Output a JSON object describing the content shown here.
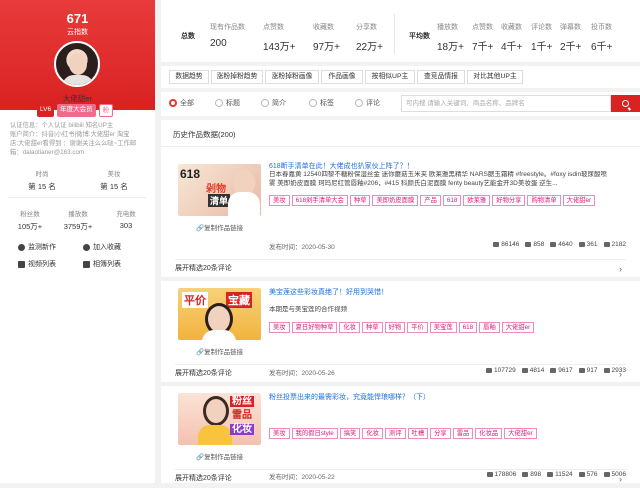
{
  "profile": {
    "rank": "671",
    "rank_label": "云指数",
    "name": "大佬甜er",
    "badges": [
      "LV6",
      "年度大会员",
      "粉"
    ],
    "info": [
      "认证信息：个人认证 bilibili 知名UP主",
      "账户简介：抖音|小红书|微博:大佬甜er 淘宝",
      "店:大佬甜er看得到 ：谢谢关注么么哒~工作邮",
      "箱：dalaotianer@163.com"
    ],
    "stat_row1": [
      {
        "label": "时尚",
        "value": "第 15 名"
      },
      {
        "label": "美妆",
        "value": "第 15 名"
      }
    ],
    "stat_row2": [
      {
        "label": "粉丝数",
        "value": "105万+"
      },
      {
        "label": "播放数",
        "value": "3759万+"
      },
      {
        "label": "充电数",
        "value": "303"
      }
    ],
    "actions": [
      {
        "icon": "monitor-icon",
        "label": "监测新作"
      },
      {
        "icon": "plus-circle-icon",
        "label": "加入收藏"
      },
      {
        "icon": "video-list-icon",
        "label": "视频列表"
      },
      {
        "icon": "album-list-icon",
        "label": "相簿列表"
      }
    ]
  },
  "totals": {
    "label": "总数",
    "cols": [
      {
        "label": "现有作品数",
        "value": "200"
      },
      {
        "label": "点赞数",
        "value": "143万+"
      },
      {
        "label": "收藏数",
        "value": "97万+"
      },
      {
        "label": "分享数",
        "value": "22万+"
      }
    ]
  },
  "averages": {
    "label": "平均数",
    "cols": [
      {
        "label": "播放数",
        "value": "18万+"
      },
      {
        "label": "点赞数",
        "value": "7千+"
      },
      {
        "label": "收藏数",
        "value": "4千+"
      },
      {
        "label": "评论数",
        "value": "1千+"
      },
      {
        "label": "弹幕数",
        "value": "2千+"
      },
      {
        "label": "投币数",
        "value": "6千+"
      }
    ]
  },
  "tabs": [
    "数据趋势",
    "涨粉掉粉趋势",
    "涨粉掉粉画像",
    "作品画像",
    "按相似UP主",
    "查竞品情报",
    "对比其他UP主"
  ],
  "filters": {
    "options": [
      "全部",
      "标题",
      "简介",
      "标签",
      "评论"
    ],
    "selected": "全部",
    "search_placeholder": "可内搜 请输入关键词、商品名称、品牌名"
  },
  "history": {
    "title": "历史作品数据(200)",
    "posts": [
      {
        "title": "618断手清单在此！大佬成也扒家伙上阵了？！",
        "desc": "日本春嘉黄 12540四黎不糖粉保湿丝金 迷你蘑菇玉米夹 欧莱雅黑精华 NARS腮玉霜精 #freestyle。#foxy isdin玻尿酸喷雾 美即奶皮面膜 珂玛尼红管唇釉#206，#415 科颜氏白泥面膜 fenty beauty艺能金开3D美妆蛋 逆生...",
        "tags": [
          "美妆",
          "618剁手清单大会",
          "种草",
          "美即奶皮面膜",
          "产品",
          "618",
          "欧莱雅",
          "好物分享",
          "购物清单",
          "大佬甜er"
        ],
        "cover_caption": "复制作品链接",
        "date": "发布时间：2020-05-30",
        "stats": [
          "86146",
          "858",
          "4640",
          "361",
          "2182"
        ],
        "expand": "展开精选20条评论"
      },
      {
        "title": "美宝莲这些彩妆真绝了！好用到哭惜！",
        "desc": "本期是与美宝莲的合作视频",
        "tags": [
          "美妆",
          "夏日好物种草",
          "化妆",
          "种草",
          "好物",
          "平价",
          "美宝莲",
          "618",
          "唇釉",
          "大佬甜er"
        ],
        "cover_caption": "复制作品链接",
        "date": "发布时间：2020-05-26",
        "stats": [
          "107729",
          "4814",
          "9617",
          "917",
          "2933"
        ],
        "expand": "展开精选20条评论"
      },
      {
        "title": "粉丝投票出来的最需彩妆，究竟能悍琅哪样？（下）",
        "desc": "",
        "tags": [
          "美妆",
          "我的假日style",
          "搞笑",
          "化妆",
          "测评",
          "吐槽",
          "分享",
          "雷品",
          "化妆品",
          "大佬甜er"
        ],
        "cover_caption": "复制作品链接",
        "date": "发布时间：2020-05-22",
        "stats": [
          "178806",
          "898",
          "11524",
          "576",
          "5006"
        ],
        "expand": "展开精选20条评论"
      }
    ],
    "thumb_texts": [
      [
        "618",
        "剁物",
        "清单"
      ],
      [
        "平价",
        "宝藏"
      ],
      [
        "粉丝",
        "雷品",
        "化妆"
      ]
    ]
  }
}
